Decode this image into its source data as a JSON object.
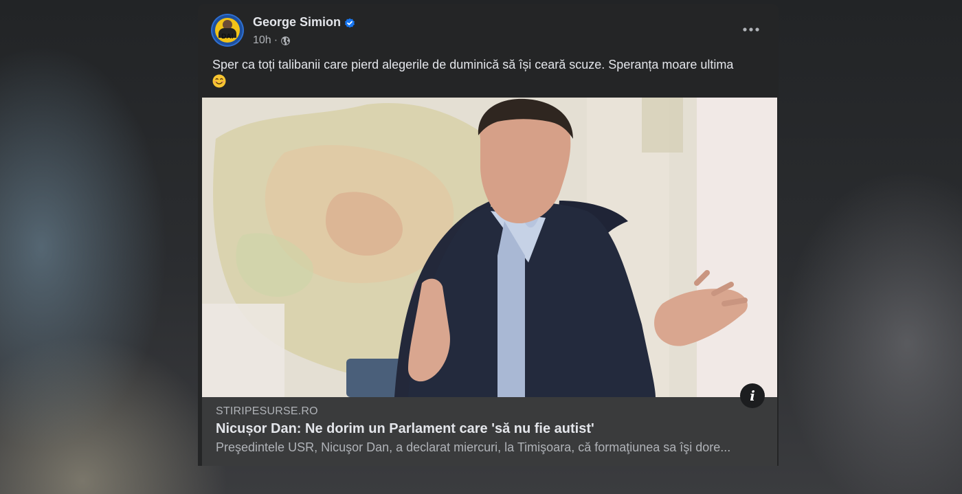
{
  "post": {
    "author_name": "George Simion",
    "avatar_text": "DA!",
    "time": "10h",
    "separator": "·",
    "privacy_icon": "globe-icon",
    "verified_icon": "verified-badge-icon",
    "more_icon": "more-options-icon",
    "text": "Sper ca toți talibanii care pierd alegerile de duminică să își ceară scuze. Speranța moare ultima",
    "emoji": "smiling-face-emoji"
  },
  "link_preview": {
    "domain": "STIRIPESURSE.RO",
    "headline": "Nicușor Dan: Ne dorim un Parlament care 'să nu fie autist'",
    "description": "Preşedintele USR, Nicuşor Dan, a declarat miercuri, la Timişoara, că formaţiunea sa îşi dore...",
    "info_icon": "info-icon",
    "info_label": "i"
  },
  "colors": {
    "card_bg": "#242526",
    "link_bg": "#3a3b3c",
    "text_primary": "#e4e6eb",
    "text_secondary": "#b0b3b8",
    "verified_blue": "#1877f2"
  }
}
